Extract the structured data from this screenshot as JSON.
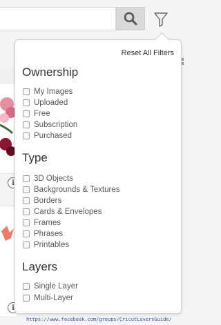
{
  "search": {
    "value": "",
    "placeholder": ""
  },
  "filters": {
    "reset_label": "Reset All Filters",
    "sections": [
      {
        "title": "Ownership",
        "options": [
          "My Images",
          "Uploaded",
          "Free",
          "Subscription",
          "Purchased"
        ]
      },
      {
        "title": "Type",
        "options": [
          "3D Objects",
          "Backgrounds & Textures",
          "Borders",
          "Cards & Envelopes",
          "Frames",
          "Phrases",
          "Printables"
        ]
      },
      {
        "title": "Layers",
        "options": [
          "Single Layer",
          "Multi-Layer"
        ]
      }
    ]
  },
  "background": {
    "info_glyph": "i"
  },
  "footer": {
    "url": "https://www.facebook.com/groups/CricutLoversGuide/"
  },
  "colors": {
    "link": "#2e55a8",
    "popover_border": "#cfcfcf",
    "search_button": "#d9d9d9"
  },
  "icons": [
    "search-icon",
    "filter-funnel-icon",
    "grid-view-icon",
    "info-icon"
  ]
}
